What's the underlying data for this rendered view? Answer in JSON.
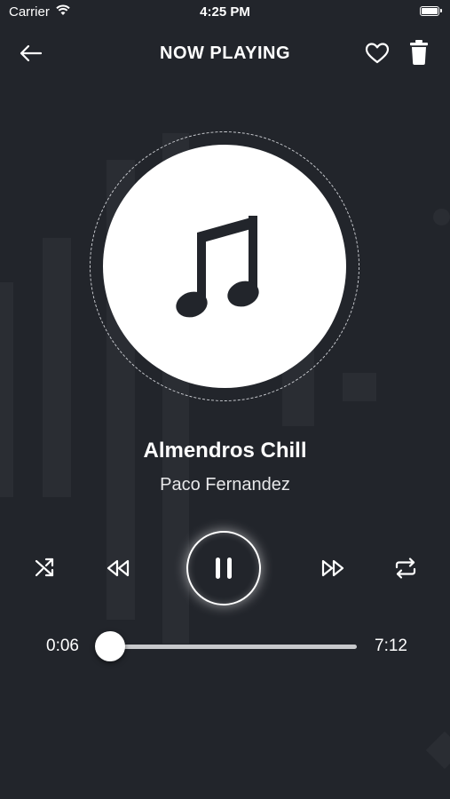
{
  "status_bar": {
    "carrier": "Carrier",
    "time": "4:25 PM"
  },
  "header": {
    "title": "NOW PLAYING"
  },
  "track": {
    "title": "Almendros Chill",
    "artist": "Paco Fernandez"
  },
  "progress": {
    "elapsed": "0:06",
    "duration": "7:12",
    "fraction": 0.014
  },
  "colors": {
    "background": "#22252b",
    "accent": "#ffffff",
    "decor_bars": "#2a2d33"
  },
  "icons": {
    "back": "arrow-left-icon",
    "favorite": "heart-outline-icon",
    "delete": "trash-icon",
    "album": "music-note-icon",
    "shuffle": "shuffle-icon",
    "rewind": "rewind-icon",
    "pause": "pause-icon",
    "forward": "fast-forward-icon",
    "repeat": "repeat-icon"
  }
}
